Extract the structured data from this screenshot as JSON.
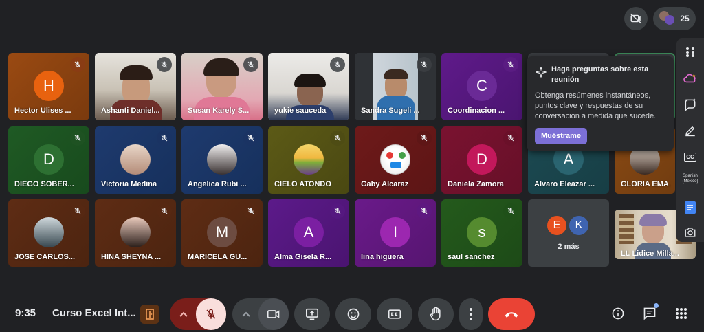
{
  "top": {
    "participant_count": "25"
  },
  "tiles": [
    {
      "name": "Hector Ulises ...",
      "initial": "H"
    },
    {
      "name": "Ashanti Daniel..."
    },
    {
      "name": "Susan Karely S..."
    },
    {
      "name": "yukie sauceda"
    },
    {
      "name": "Sandra Sugeli ..."
    },
    {
      "name": "Coordinacion ...",
      "initial": "C"
    },
    {
      "name": "DIEGO SOBER...",
      "initial": "D"
    },
    {
      "name": "Victoria Medina"
    },
    {
      "name": "Angelica Rubi ..."
    },
    {
      "name": "CIELO ATONDO"
    },
    {
      "name": "Gaby Alcaraz"
    },
    {
      "name": "Daniela Zamora",
      "initial": "D"
    },
    {
      "name": "Alvaro Eleazar ...",
      "initial": "A"
    },
    {
      "name": "GLORIA EMA ..."
    },
    {
      "name": "JOSE CARLOS..."
    },
    {
      "name": "HINA SHEYNA ..."
    },
    {
      "name": "MARICELA GU...",
      "initial": "M"
    },
    {
      "name": "Alma Gisela R...",
      "initial": "A"
    },
    {
      "name": "lina higuera",
      "initial": "I"
    },
    {
      "name": "saul sanchez",
      "initial": "s"
    },
    {
      "name": "Lt. Lidice Milla..."
    }
  ],
  "more": {
    "initial_1": "E",
    "initial_2": "K",
    "label": "2 más"
  },
  "popup": {
    "title": "Haga preguntas sobre esta reunión",
    "body": "Obtenga resúmenes instantáneos, puntos clave y respuestas de su conversación a medida que sucede.",
    "button": "Muéstrame"
  },
  "side": {
    "captions_badge": "CC",
    "language": "Spanish (Mexico)"
  },
  "bottom": {
    "time": "9:35",
    "meeting_title": "Curso Excel Int..."
  },
  "colors": {
    "leave": "#ea4335",
    "mic_off": "#f9dedc",
    "accent": "#8ab4f8"
  }
}
